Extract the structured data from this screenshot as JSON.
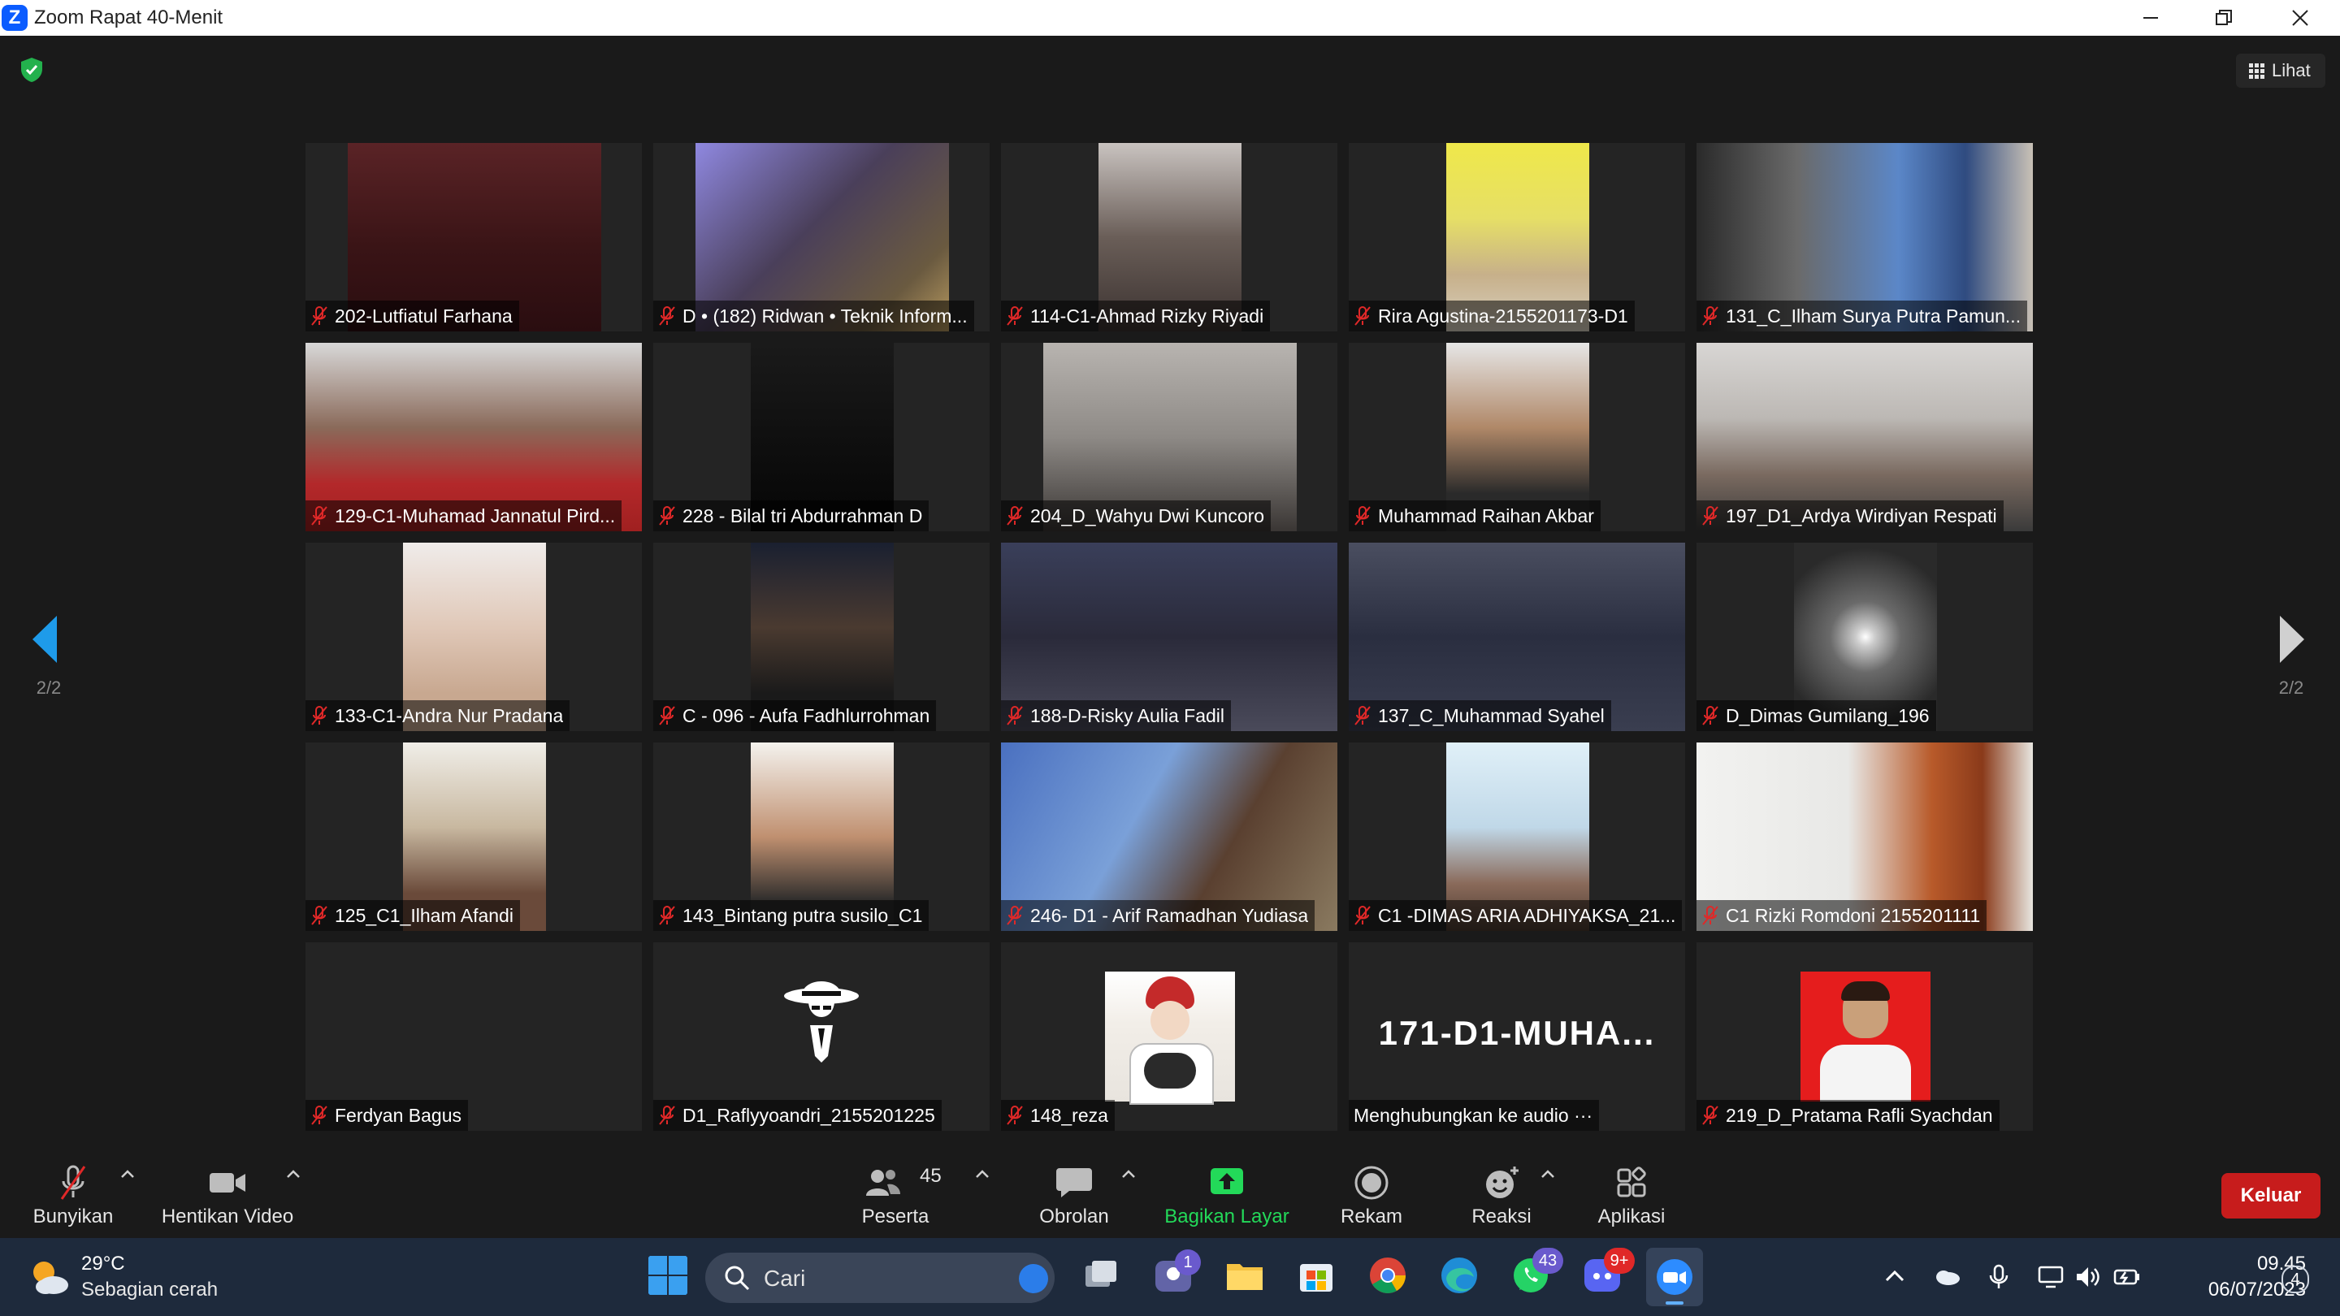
{
  "window": {
    "title": "Zoom Rapat 40-Menit"
  },
  "view_button": {
    "label": "Lihat"
  },
  "pages": {
    "left_label": "2/2",
    "right_label": "2/2"
  },
  "participants": [
    {
      "name": "202-Lutfiatul Farhana"
    },
    {
      "name": "D • (182) Ridwan • Teknik Inform..."
    },
    {
      "name": "114-C1-Ahmad Rizky Riyadi"
    },
    {
      "name": "Rira Agustina-2155201173-D1"
    },
    {
      "name": "131_C_Ilham Surya Putra Pamun..."
    },
    {
      "name": "129-C1-Muhamad Jannatul Pird..."
    },
    {
      "name": "228 - Bilal tri Abdurrahman D"
    },
    {
      "name": "204_D_Wahyu Dwi Kuncoro"
    },
    {
      "name": "Muhammad Raihan Akbar"
    },
    {
      "name": "197_D1_Ardya Wirdiyan Respati"
    },
    {
      "name": "133-C1-Andra Nur Pradana"
    },
    {
      "name": "C - 096 - Aufa Fadhlurrohman"
    },
    {
      "name": "188-D-Risky Aulia Fadil"
    },
    {
      "name": "137_C_Muhammad Syahel"
    },
    {
      "name": "D_Dimas Gumilang_196"
    },
    {
      "name": "125_C1_Ilham Afandi"
    },
    {
      "name": "143_Bintang putra susilo_C1"
    },
    {
      "name": "246- D1 - Arif Ramadhan Yudiasa"
    },
    {
      "name": "C1 -DIMAS ARIA ADHIYAKSA_21..."
    },
    {
      "name": "C1 Rizki Romdoni 2155201111"
    },
    {
      "name": "Ferdyan Bagus"
    },
    {
      "name": "D1_Raflyyoandri_2155201225"
    },
    {
      "name": "148_reza"
    },
    {
      "name": "Menghubungkan ke audio ···",
      "display_name": "171-D1-MUHA..."
    },
    {
      "name": "219_D_Pratama Rafli Syachdan"
    }
  ],
  "toolbar": {
    "unmute": "Bunyikan",
    "stop_video": "Hentikan Video",
    "participants": "Peserta",
    "participants_count": "45",
    "chat": "Obrolan",
    "share": "Bagikan Layar",
    "record": "Rekam",
    "reactions": "Reaksi",
    "apps": "Aplikasi",
    "leave": "Keluar"
  },
  "taskbar": {
    "temperature": "29°C",
    "weather": "Sebagian cerah",
    "search_placeholder": "Cari",
    "teams_badge": "1",
    "whatsapp_badge": "43",
    "discord_badge": "9+",
    "time": "09.45",
    "date": "06/07/2023",
    "notifications": "4"
  },
  "colors": {
    "accent": "#0b5cff",
    "share_green": "#23d959",
    "leave_red": "#c71c1c",
    "mute_red": "#e02828"
  }
}
